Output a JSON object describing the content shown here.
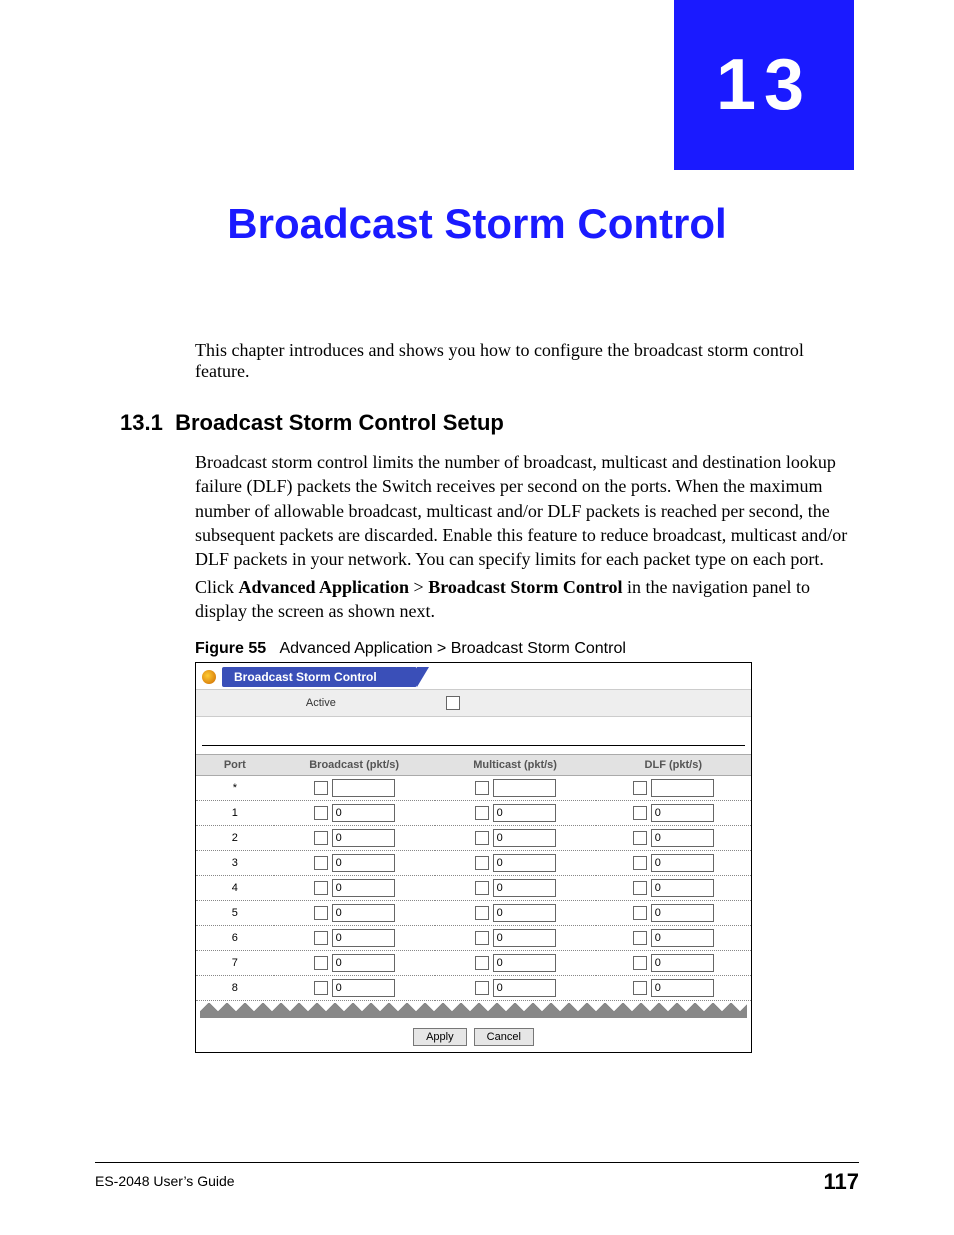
{
  "chapter": {
    "number": "13",
    "title": "Broadcast Storm Control"
  },
  "intro": "This chapter introduces and shows you how to configure the broadcast storm control feature.",
  "section": {
    "number": "13.1",
    "title": "Broadcast Storm Control Setup"
  },
  "para1": "Broadcast storm control limits the number of broadcast, multicast and destination lookup failure (DLF) packets the Switch receives per second on the ports. When the maximum number of allowable broadcast, multicast and/or DLF packets is reached per second, the subsequent packets are discarded. Enable this feature to reduce broadcast, multicast and/or DLF packets in your network. You can specify limits for each packet type on each port.",
  "para2_pre": "Click ",
  "para2_b1": "Advanced Application",
  "para2_mid": " > ",
  "para2_b2": "Broadcast Storm Control",
  "para2_post": " in the navigation panel to display the screen as shown next.",
  "figure": {
    "label": "Figure 55",
    "caption": "Advanced Application > Broadcast Storm Control"
  },
  "screenshot": {
    "title": "Broadcast Storm Control",
    "active_label": "Active",
    "columns": {
      "port": "Port",
      "broadcast": "Broadcast (pkt/s)",
      "multicast": "Multicast (pkt/s)",
      "dlf": "DLF (pkt/s)"
    },
    "rows": [
      {
        "port": "*",
        "broadcast": "",
        "multicast": "",
        "dlf": ""
      },
      {
        "port": "1",
        "broadcast": "0",
        "multicast": "0",
        "dlf": "0"
      },
      {
        "port": "2",
        "broadcast": "0",
        "multicast": "0",
        "dlf": "0"
      },
      {
        "port": "3",
        "broadcast": "0",
        "multicast": "0",
        "dlf": "0"
      },
      {
        "port": "4",
        "broadcast": "0",
        "multicast": "0",
        "dlf": "0"
      },
      {
        "port": "5",
        "broadcast": "0",
        "multicast": "0",
        "dlf": "0"
      },
      {
        "port": "6",
        "broadcast": "0",
        "multicast": "0",
        "dlf": "0"
      },
      {
        "port": "7",
        "broadcast": "0",
        "multicast": "0",
        "dlf": "0"
      },
      {
        "port": "8",
        "broadcast": "0",
        "multicast": "0",
        "dlf": "0"
      }
    ],
    "buttons": {
      "apply": "Apply",
      "cancel": "Cancel"
    }
  },
  "footer": {
    "guide": "ES-2048 User’s Guide",
    "page": "117"
  }
}
